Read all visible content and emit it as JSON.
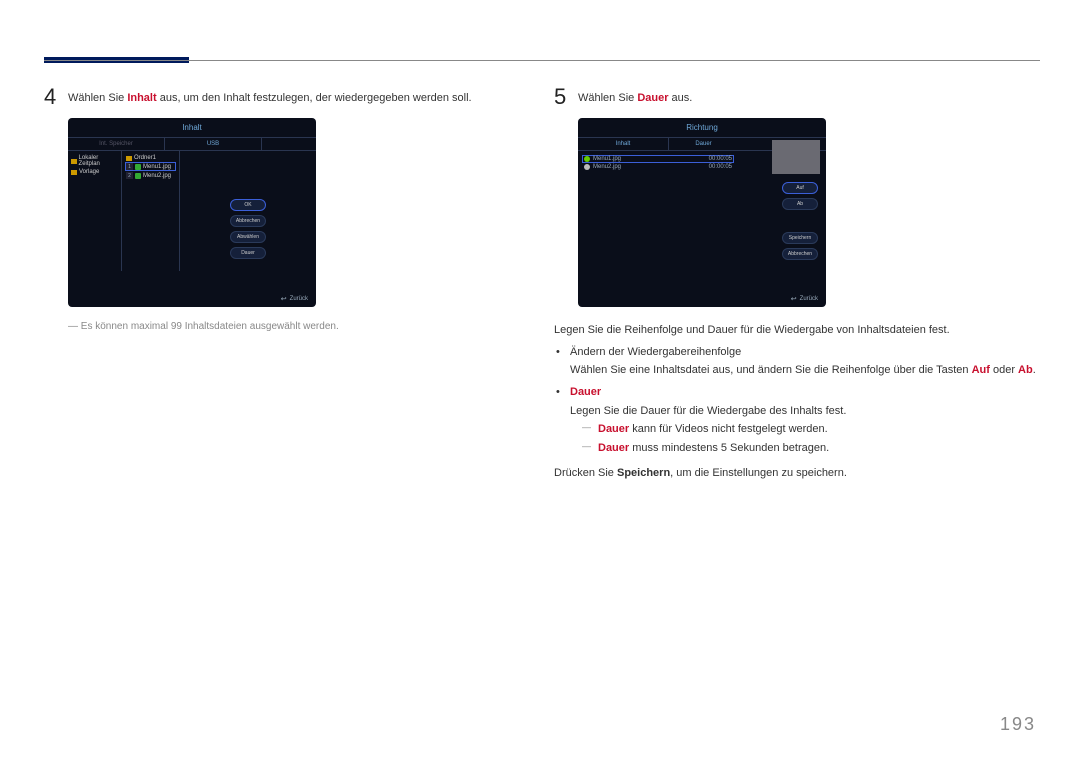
{
  "page_number": "193",
  "step4": {
    "num": "4",
    "text_pre": "Wählen Sie ",
    "text_emph": "Inhalt",
    "text_post": " aus, um den Inhalt festzulegen, der wiedergegeben werden soll."
  },
  "step5": {
    "num": "5",
    "text_pre": "Wählen Sie ",
    "text_emph": "Dauer",
    "text_post": " aus."
  },
  "screen1": {
    "title": "Inhalt",
    "tab1": "Int. Speicher",
    "tab2": "USB",
    "side_item1": "Lokaler Zeitplan",
    "side_item2": "Vorlage",
    "folder_label": "Ordner1",
    "file1_num": "1",
    "file1_name": "Menu1.jpg",
    "file2_num": "2",
    "file2_name": "Menu2.jpg",
    "btn_ok": "OK",
    "btn_cancel": "Abbrechen",
    "btn_deselect": "Abwählen",
    "btn_dauer": "Dauer",
    "footer": "Zurück"
  },
  "screen2": {
    "title": "Richtung",
    "col1": "Inhalt",
    "col2": "Dauer",
    "file1": "Menu1.jpg",
    "dur1": "00:00:05",
    "file2": "Menu2.jpg",
    "dur2": "00:00:05",
    "btn_up": "Auf",
    "btn_down": "Ab",
    "btn_save": "Speichern",
    "btn_cancel": "Abbrechen",
    "footer": "Zurück"
  },
  "note4_dash": "―",
  "note4": "Es können maximal 99 Inhaltsdateien ausgewählt werden.",
  "body5": {
    "line1": "Legen Sie die Reihenfolge und Dauer für die Wiedergabe von Inhaltsdateien fest.",
    "bullet1_title": "Ändern der Wiedergabereihenfolge",
    "bullet1_text_pre": "Wählen Sie eine Inhaltsdatei aus, und ändern Sie die Reihenfolge über die Tasten ",
    "bullet1_auf": "Auf",
    "bullet1_or": " oder ",
    "bullet1_ab": "Ab",
    "bullet1_dot": ".",
    "bullet2_title": "Dauer",
    "bullet2_text": "Legen Sie die Dauer für die Wiedergabe des Inhalts fest.",
    "sub1_emph": "Dauer",
    "sub1_rest": " kann für Videos nicht festgelegt werden.",
    "sub2_emph": "Dauer",
    "sub2_rest": " muss mindestens 5 Sekunden betragen.",
    "line_last_pre": "Drücken Sie ",
    "line_last_emph": "Speichern",
    "line_last_post": ", um die Einstellungen zu speichern."
  }
}
